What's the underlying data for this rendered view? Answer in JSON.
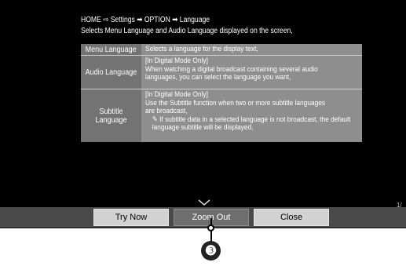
{
  "header": {
    "breadcrumb": "HOME ⇨ Settings ➡ OPTION ➡ Language",
    "description": "Selects Menu Language and Audio Language displayed on the screen,"
  },
  "table": {
    "rows": [
      {
        "label": "Menu Language",
        "lines": [
          "Selects a language for the display text,"
        ]
      },
      {
        "label": "Audio Language",
        "lines": [
          "[In Digital Mode Only]",
          "When watching a digital broadcast containing several audio",
          "languages, you can select the language you want,"
        ]
      },
      {
        "label": "Subtitle Language",
        "lines": [
          "[In Digital Mode Only]",
          "Use the Subtitle function when two or more subtitle languages",
          "are broadcast,"
        ],
        "note": "✎ If subtitle data in a selected language is not broadcast, the default language subtitle will be displayed,"
      }
    ]
  },
  "scroll_icon": "chevron-down-icon",
  "buttons": {
    "try_now": "Try Now",
    "zoom_out": "Zoom Out",
    "close": "Close"
  },
  "page_indicator": "1/",
  "callout": {
    "number": "❸"
  },
  "colors": {
    "screen_bg": "#000000",
    "table_bg": "#8e8e8e",
    "label_bg": "#737373",
    "button_bg": "#d2d2d2",
    "button_selected_bg": "#6e6e6e"
  }
}
